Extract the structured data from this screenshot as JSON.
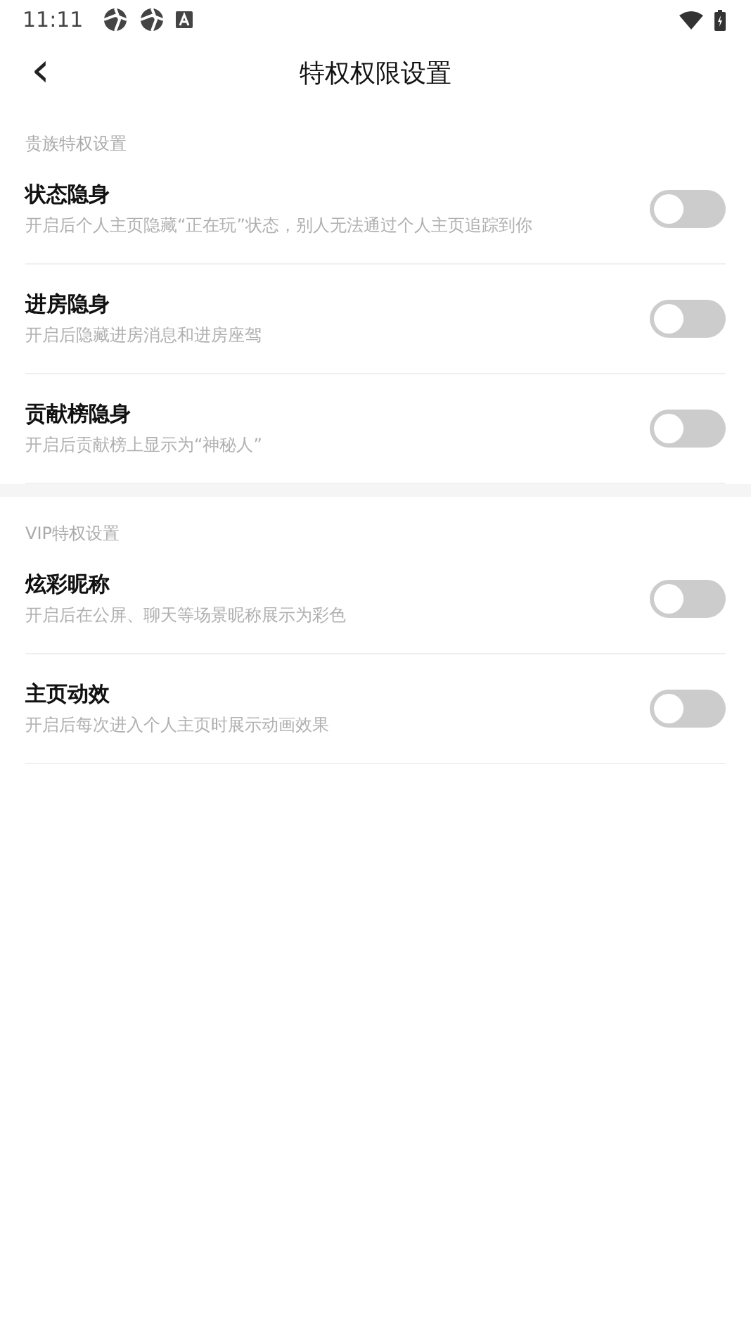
{
  "status_bar": {
    "time": "11:11"
  },
  "header": {
    "back": "‹",
    "title": "特权权限设置"
  },
  "sections": [
    {
      "label": "贵族特权设置",
      "items": [
        {
          "title": "状态隐身",
          "description": "开启后个人主页隐藏“正在玩”状态，别人无法通过个人主页追踪到你",
          "on": false
        },
        {
          "title": "进房隐身",
          "description": "开启后隐藏进房消息和进房座驾",
          "on": false
        },
        {
          "title": "贡献榜隐身",
          "description": "开启后贡献榜上显示为“神秘人”",
          "on": false
        }
      ]
    },
    {
      "label": "VIP特权设置",
      "items": [
        {
          "title": "炫彩昵称",
          "description": "开启后在公屏、聊天等场景昵称展示为彩色",
          "on": false
        },
        {
          "title": "主页动效",
          "description": "开启后每次进入个人主页时展示动画效果",
          "on": false
        }
      ]
    }
  ]
}
